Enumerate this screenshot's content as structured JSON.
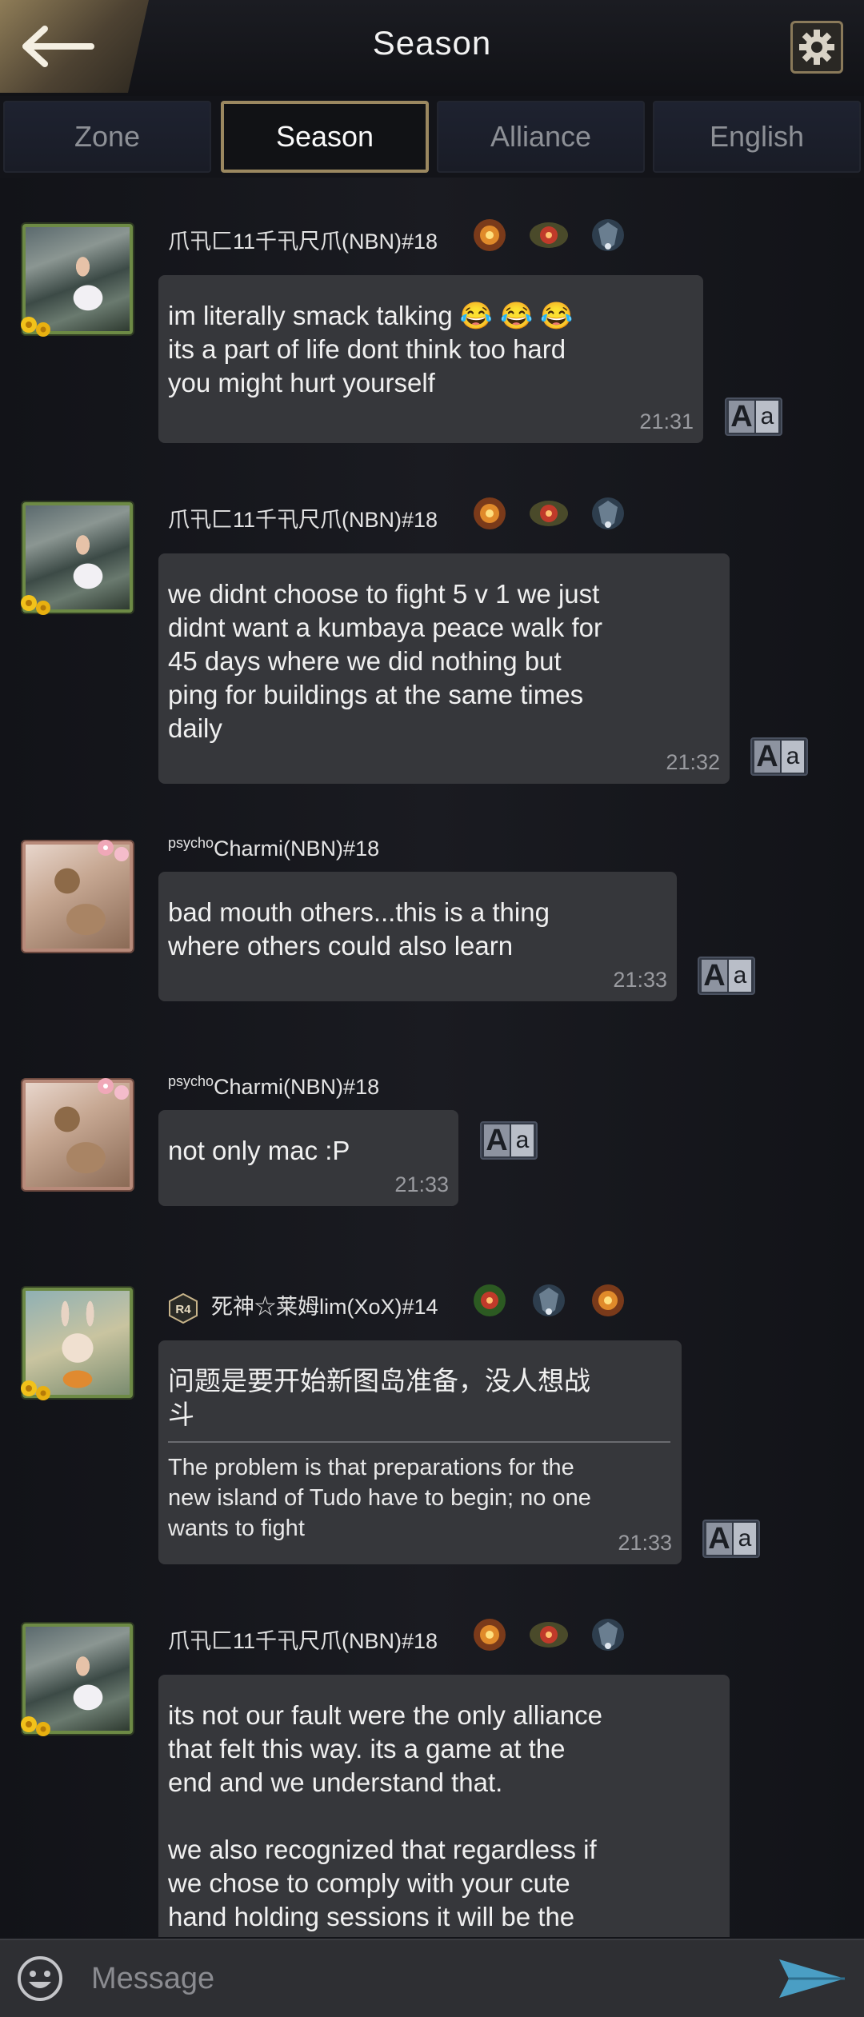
{
  "header": {
    "title": "Season"
  },
  "tabs": [
    {
      "label": "Zone",
      "active": false
    },
    {
      "label": "Season",
      "active": true
    },
    {
      "label": "Alliance",
      "active": false
    },
    {
      "label": "English",
      "active": false
    }
  ],
  "messages": [
    {
      "sender": "爪卂匚11千卂尺爪(NBN)#18",
      "text": "im literally smack talking 😂 😂 😂\nits a part of life dont think too hard\nyou might hurt yourself",
      "time": "21:31"
    },
    {
      "sender": "爪卂匚11千卂尺爪(NBN)#18",
      "text": "we didnt choose to fight 5 v 1 we just\ndidnt want a kumbaya peace walk for\n45 days where we did nothing but\nping for buildings at the same times\ndaily",
      "time": "21:32"
    },
    {
      "sender_prefix": "psycho",
      "sender": "Charmi(NBN)#18",
      "text": "bad mouth others...this is a thing\nwhere others could also learn",
      "time": "21:33"
    },
    {
      "sender_prefix": "psycho",
      "sender": "Charmi(NBN)#18",
      "text": "not only mac :P",
      "time": "21:33"
    },
    {
      "rank": "R4",
      "sender": "死神☆莱姆lim(XoX)#14",
      "text": "问题是要开始新图岛准备，没人想战\n斗",
      "translation": "The problem is that preparations for the\nnew island of Tudo have to begin; no one\n wants to fight",
      "time": "21:33"
    },
    {
      "sender": "爪卂匚11千卂尺爪(NBN)#18",
      "text": "its not our fault were the only alliance\nthat felt this way. its a game at the\nend and we understand that.\n\nwe also recognized that regardless if\nwe chose to comply with your cute\nhand holding sessions it will be the"
    }
  ],
  "translate_button": {
    "big": "A",
    "small": "a"
  },
  "composer": {
    "placeholder": "Message"
  }
}
